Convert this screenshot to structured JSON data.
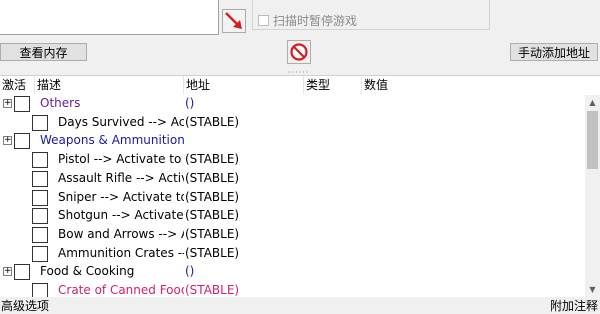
{
  "options": {
    "pause_game_label": "扫描时暂停游戏"
  },
  "toolbar": {
    "view_memory_label": "查看内存",
    "add_address_label": "手动添加地址",
    "splitter_glyph": "······"
  },
  "table": {
    "columns": [
      "激活",
      "描述",
      "地址",
      "类型",
      "数值"
    ],
    "rows": [
      {
        "level": 0,
        "expandable": true,
        "checked": false,
        "description": "Others",
        "address": "()",
        "color": "#6a1a9a"
      },
      {
        "level": 1,
        "expandable": false,
        "checked": false,
        "description": "Days Survived --> Activ",
        "address": "(STABLE)",
        "color": "#000000"
      },
      {
        "level": 0,
        "expandable": true,
        "checked": false,
        "description": "Weapons & Ammunition",
        "address": "",
        "color": "#1a1aa0"
      },
      {
        "level": 1,
        "expandable": false,
        "checked": false,
        "description": "Pistol --> Activate to Fr",
        "address": "(STABLE)",
        "color": "#000000"
      },
      {
        "level": 1,
        "expandable": false,
        "checked": false,
        "description": "Assault Rifle --> Activat",
        "address": "(STABLE)",
        "color": "#000000"
      },
      {
        "level": 1,
        "expandable": false,
        "checked": false,
        "description": "Sniper --> Activate to F",
        "address": "(STABLE)",
        "color": "#000000"
      },
      {
        "level": 1,
        "expandable": false,
        "checked": false,
        "description": "Shotgun --> Activate to",
        "address": "(STABLE)",
        "color": "#000000"
      },
      {
        "level": 1,
        "expandable": false,
        "checked": false,
        "description": "Bow and Arrows --> Ac",
        "address": "(STABLE)",
        "color": "#000000"
      },
      {
        "level": 1,
        "expandable": false,
        "checked": false,
        "description": "Ammunition Crates -->",
        "address": "(STABLE)",
        "color": "#000000"
      },
      {
        "level": 0,
        "expandable": true,
        "checked": false,
        "description": "Food & Cooking",
        "address": "()",
        "color": "#000000"
      },
      {
        "level": 1,
        "expandable": false,
        "checked": false,
        "description": "Crate of Canned Food",
        "address": "(STABLE)",
        "color": "#d02070"
      }
    ]
  },
  "bottom": {
    "advanced_options_label": "高级选项",
    "add_comment_label": "附加注释"
  },
  "icons": {
    "expand": "⊞",
    "scroll_up": "▲",
    "scroll_down": "▼"
  }
}
